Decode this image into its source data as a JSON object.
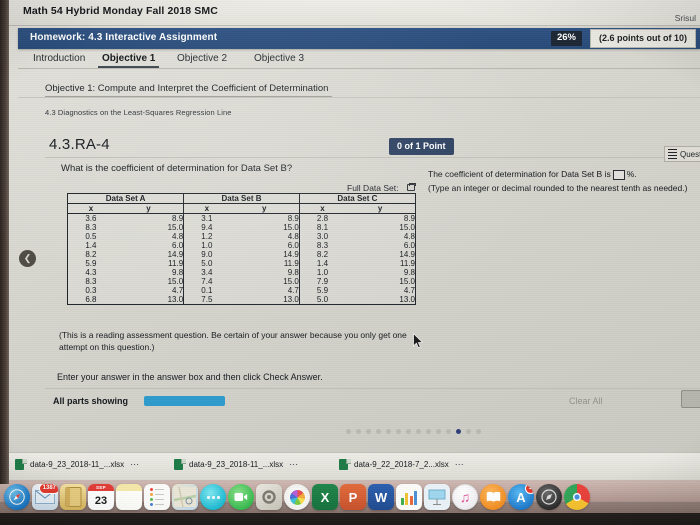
{
  "course": {
    "title": "Math 54 Hybrid Monday Fall 2018 SMC",
    "user": "Srisul"
  },
  "homework": {
    "title": "Homework: 4.3 Interactive Assignment",
    "score_percent": "26%",
    "score_points": "(2.6 points out of 10)"
  },
  "tabs": [
    {
      "label": "Introduction",
      "active": false
    },
    {
      "label": "Objective 1",
      "active": true
    },
    {
      "label": "Objective 2",
      "active": false
    },
    {
      "label": "Objective 3",
      "active": false
    }
  ],
  "objective": {
    "heading": "Objective 1: Compute and Interpret the Coefficient of Determination",
    "subheading": "4.3 Diagnostics on the Least-Squares Regression Line"
  },
  "question": {
    "number": "4.3.RA-4",
    "points_badge": "0 of 1 Point",
    "help_label": "Question Help",
    "prompt": "What is the coefficient of determination for Data Set B?",
    "full_data_set_label": "Full Data Set:",
    "note": "(This is a reading assessment question.  Be certain of your answer because you only get one attempt on this question.)",
    "enter_instruction": "Enter your answer in the answer box and then click Check Answer.",
    "all_parts_label": "All parts showing",
    "clear_all_label": "Clear All"
  },
  "answer_panel": {
    "prefix": "The coefficient of determination for Data Set B is",
    "suffix": "%.",
    "value": "",
    "hint": "(Type an integer or decimal rounded to the nearest tenth as needed.)"
  },
  "chart_data": {
    "type": "table",
    "title": "Full Data Set",
    "tables": [
      {
        "name": "Data Set A",
        "columns": [
          "x",
          "y"
        ],
        "x": [
          3.6,
          8.3,
          0.5,
          1.4,
          8.2,
          5.9,
          4.3,
          8.3,
          0.3,
          6.8
        ],
        "y": [
          8.9,
          15.0,
          4.8,
          6.0,
          14.9,
          11.9,
          9.8,
          15.0,
          4.7,
          13.0
        ]
      },
      {
        "name": "Data Set B",
        "columns": [
          "x",
          "y"
        ],
        "x": [
          3.1,
          9.4,
          1.2,
          1.0,
          9.0,
          5.0,
          3.4,
          7.4,
          0.1,
          7.5
        ],
        "y": [
          8.9,
          15.0,
          4.8,
          6.0,
          14.9,
          11.9,
          9.8,
          15.0,
          4.7,
          13.0
        ]
      },
      {
        "name": "Data Set C",
        "columns": [
          "x",
          "y"
        ],
        "x": [
          2.8,
          8.1,
          3.0,
          8.3,
          8.2,
          1.4,
          1.0,
          7.9,
          5.9,
          5.0
        ],
        "y": [
          8.9,
          15.0,
          4.8,
          6.0,
          14.9,
          11.9,
          9.8,
          15.0,
          4.7,
          13.0
        ]
      }
    ]
  },
  "table_rows": [
    {
      "ax": "3.6",
      "ay": "8.9",
      "bx": "3.1",
      "by": "8.9",
      "cx": "2.8",
      "cy": "8.9"
    },
    {
      "ax": "8.3",
      "ay": "15.0",
      "bx": "9.4",
      "by": "15.0",
      "cx": "8.1",
      "cy": "15.0"
    },
    {
      "ax": "0.5",
      "ay": "4.8",
      "bx": "1.2",
      "by": "4.8",
      "cx": "3.0",
      "cy": "4.8"
    },
    {
      "ax": "1.4",
      "ay": "6.0",
      "bx": "1.0",
      "by": "6.0",
      "cx": "8.3",
      "cy": "6.0"
    },
    {
      "ax": "8.2",
      "ay": "14.9",
      "bx": "9.0",
      "by": "14.9",
      "cx": "8.2",
      "cy": "14.9"
    },
    {
      "ax": "5.9",
      "ay": "11.9",
      "bx": "5.0",
      "by": "11.9",
      "cx": "1.4",
      "cy": "11.9"
    },
    {
      "ax": "4.3",
      "ay": "9.8",
      "bx": "3.4",
      "by": "9.8",
      "cx": "1.0",
      "cy": "9.8"
    },
    {
      "ax": "8.3",
      "ay": "15.0",
      "bx": "7.4",
      "by": "15.0",
      "cx": "7.9",
      "cy": "15.0"
    },
    {
      "ax": "0.3",
      "ay": "4.7",
      "bx": "0.1",
      "by": "4.7",
      "cx": "5.9",
      "cy": "4.7"
    },
    {
      "ax": "6.8",
      "ay": "13.0",
      "bx": "7.5",
      "by": "13.0",
      "cx": "5.0",
      "cy": "13.0"
    }
  ],
  "pager": {
    "total": 14,
    "active_index": 11
  },
  "downloads": [
    {
      "name": "data-9_23_2018-11_...xlsx",
      "menu": "⋯"
    },
    {
      "name": "data-9_23_2018-11_...xlsx",
      "menu": "⋯"
    },
    {
      "name": "data-9_22_2018-7_2...xlsx",
      "menu": "⋯"
    }
  ],
  "dock": [
    {
      "name": "safari",
      "label": ""
    },
    {
      "name": "mail",
      "label": "",
      "badge": "1387"
    },
    {
      "name": "contacts",
      "label": ""
    },
    {
      "name": "calendar",
      "label": "23",
      "month": "SEP"
    },
    {
      "name": "pages",
      "label": ""
    },
    {
      "name": "reminders",
      "label": ""
    },
    {
      "name": "maps",
      "label": ""
    },
    {
      "name": "messages",
      "label": ""
    },
    {
      "name": "facetime",
      "label": ""
    },
    {
      "name": "system-preferences",
      "label": ""
    },
    {
      "name": "photos",
      "label": ""
    },
    {
      "name": "excel",
      "label": "X"
    },
    {
      "name": "powerpoint",
      "label": "P"
    },
    {
      "name": "word",
      "label": "W"
    },
    {
      "name": "numbers",
      "label": ""
    },
    {
      "name": "keynote",
      "label": ""
    },
    {
      "name": "itunes",
      "label": "♫"
    },
    {
      "name": "ibooks",
      "label": "📖"
    },
    {
      "name": "app-store",
      "label": "A",
      "badge": "1"
    },
    {
      "name": "finder-alt",
      "label": ""
    },
    {
      "name": "chrome",
      "label": ""
    }
  ],
  "colors": {
    "hw_bar": "#2e5283",
    "badge_dark": "#1d2733",
    "point_badge": "#2b3f60",
    "blue_button": "#2e9ccd",
    "pager_active": "#2f3f77"
  }
}
